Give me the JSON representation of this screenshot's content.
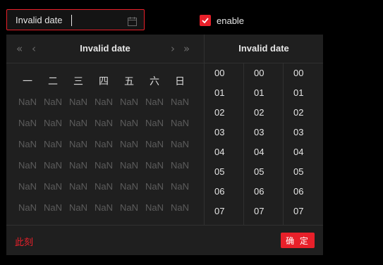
{
  "date_input": {
    "value": "Invalid date",
    "icon": "calendar-icon"
  },
  "enable": {
    "checked": true,
    "label": "enable",
    "accent": "#e8202a"
  },
  "picker": {
    "date_title": "Invalid date",
    "time_title": "Invalid date",
    "nav": {
      "super_prev": "«",
      "prev": "‹",
      "next": "›",
      "super_next": "»"
    },
    "weekdays": [
      "一",
      "二",
      "三",
      "四",
      "五",
      "六",
      "日"
    ],
    "days": [
      [
        "NaN",
        "NaN",
        "NaN",
        "NaN",
        "NaN",
        "NaN",
        "NaN"
      ],
      [
        "NaN",
        "NaN",
        "NaN",
        "NaN",
        "NaN",
        "NaN",
        "NaN"
      ],
      [
        "NaN",
        "NaN",
        "NaN",
        "NaN",
        "NaN",
        "NaN",
        "NaN"
      ],
      [
        "NaN",
        "NaN",
        "NaN",
        "NaN",
        "NaN",
        "NaN",
        "NaN"
      ],
      [
        "NaN",
        "NaN",
        "NaN",
        "NaN",
        "NaN",
        "NaN",
        "NaN"
      ],
      [
        "NaN",
        "NaN",
        "NaN",
        "NaN",
        "NaN",
        "NaN",
        "NaN"
      ]
    ],
    "hours": [
      "00",
      "01",
      "02",
      "03",
      "04",
      "05",
      "06",
      "07"
    ],
    "minutes": [
      "00",
      "01",
      "02",
      "03",
      "04",
      "05",
      "06",
      "07"
    ],
    "seconds": [
      "00",
      "01",
      "02",
      "03",
      "04",
      "05",
      "06",
      "07"
    ],
    "now_label": "此刻",
    "ok_label": "确 定"
  }
}
